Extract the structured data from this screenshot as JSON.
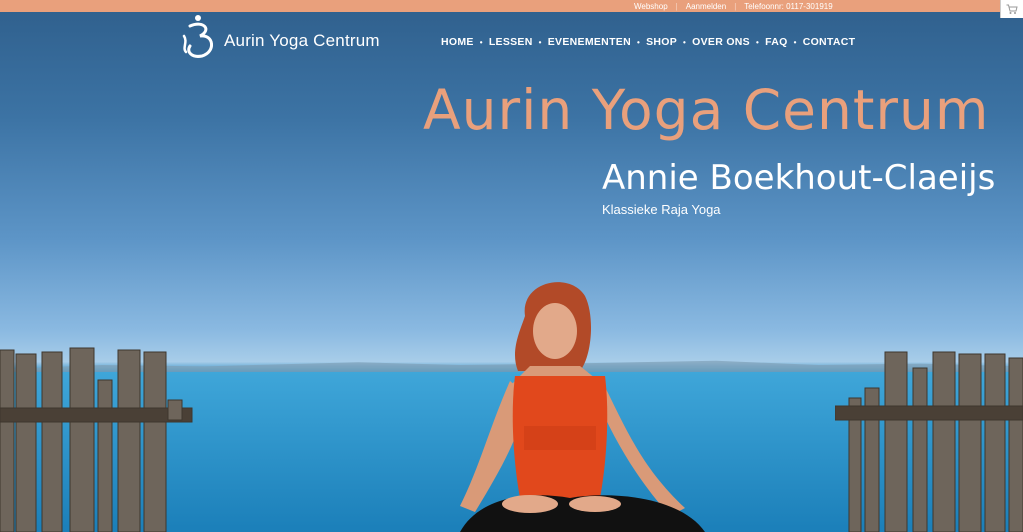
{
  "topbar": {
    "links": [
      "Webshop",
      "Aanmelden",
      "Telefoonnr: 0117-301919"
    ],
    "separator": "|",
    "cart_icon": "cart-icon"
  },
  "logo": {
    "icon": "yoga-om-icon",
    "text": "Aurin Yoga Centrum"
  },
  "nav": {
    "items": [
      "HOME",
      "LESSEN",
      "EVENEMENTEN",
      "SHOP",
      "OVER ONS",
      "FAQ",
      "CONTACT"
    ],
    "separator": "•"
  },
  "hero": {
    "title": "Aurin Yoga Centrum",
    "subtitle": "Annie Boekhout-Claeijs",
    "tagline": "Klassieke Raja Yoga"
  },
  "colors": {
    "accent": "#e9a07c",
    "text_light": "#ffffff"
  }
}
